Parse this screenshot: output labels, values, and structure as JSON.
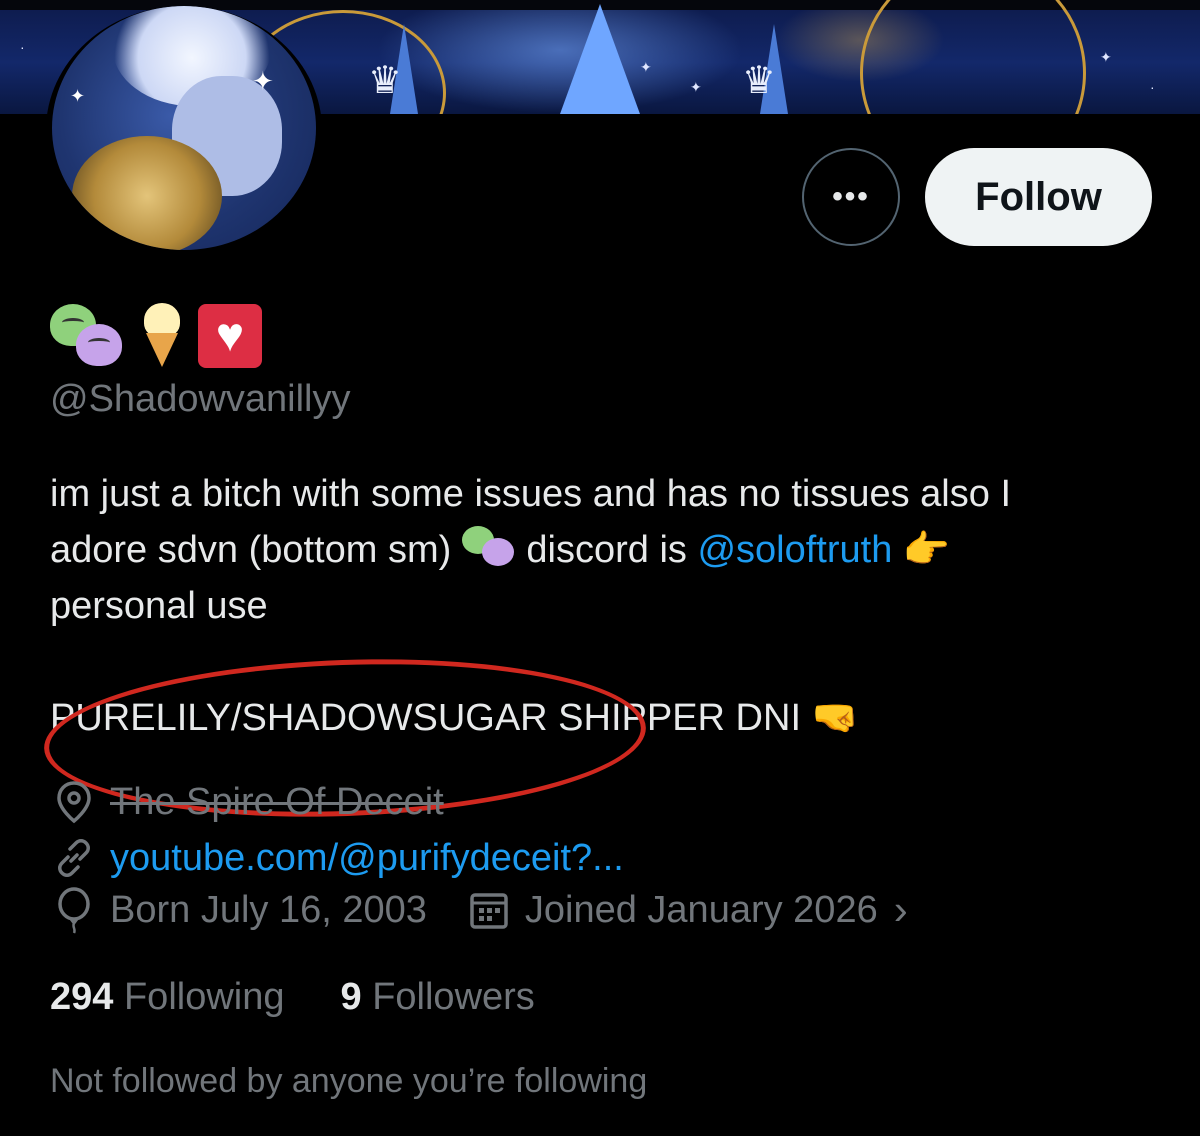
{
  "profile": {
    "display_name_emojis": [
      "performing-arts-emoji",
      "soft-ice-cream-emoji",
      "white-heart-emoji"
    ],
    "handle": "@Shadowvanillyy",
    "bio": {
      "line1": "im just a bitch with some issues and has no tissues also I",
      "line2_start": "adore sdvn (bottom sm)",
      "line2_mid": "discord is",
      "mention": "@soloftruth",
      "pointer_emoji": "👉",
      "line3": "personal use"
    },
    "dni": "PURELILY/SHADOWSUGAR SHIPPER DNI",
    "dni_emoji": "🤜",
    "location": "The Spire Of Deceit",
    "website": "youtube.com/@purifydeceit?...",
    "birthday": "Born July 16, 2003",
    "joined": "Joined January 2026",
    "following_count": "294",
    "following_label": "Following",
    "followers_count": "9",
    "followers_label": "Followers",
    "not_followed_text": "Not followed by anyone you’re following"
  },
  "actions": {
    "more_label": "•••",
    "follow_label": "Follow"
  },
  "icons": {
    "location": "location-pin-icon",
    "link": "link-icon",
    "birthday": "balloon-icon",
    "joined": "calendar-icon",
    "chevron": "chevron-right-icon"
  },
  "colors": {
    "background": "#000000",
    "text": "#e7e9ea",
    "muted": "#71767b",
    "accent": "#1d9bf0",
    "follow_bg": "#eff3f4",
    "annotation_red": "#d0281f"
  }
}
